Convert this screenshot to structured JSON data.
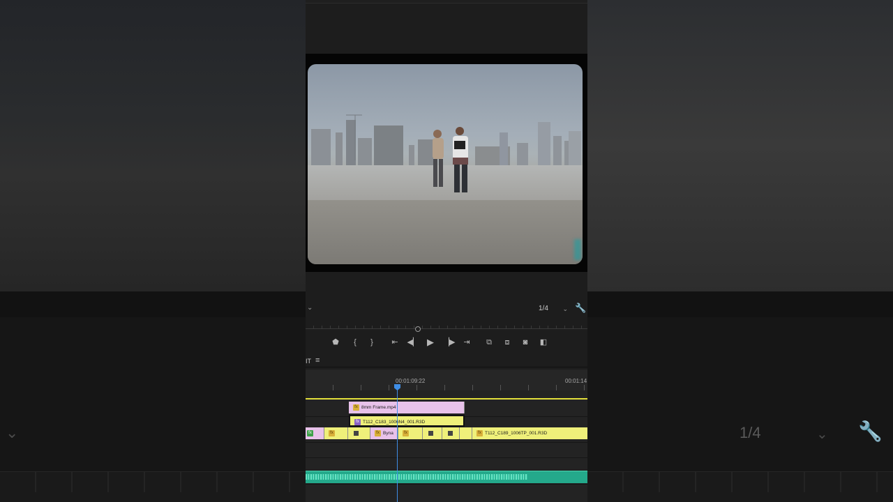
{
  "program_monitor": {
    "zoom_value": "1/4"
  },
  "timeline": {
    "tab_label": "IT",
    "timecodes": [
      "00:01:09:22",
      "00:01:14"
    ],
    "clips": {
      "v3": "8mm Frame.mp4",
      "v2": "T112_C183_1006N4_001.R3D",
      "v1_short": "Byna",
      "v1_right": "T112_C189_1006TP_001.R3D"
    }
  },
  "background": {
    "zoom_value": "1/4"
  },
  "colors": {
    "playhead": "#3f8ee6",
    "audio_track": "#24a98b",
    "clip_pink": "#e8c2ea",
    "clip_yellow": "#eff07a",
    "yellow_line": "#e2df3b"
  }
}
